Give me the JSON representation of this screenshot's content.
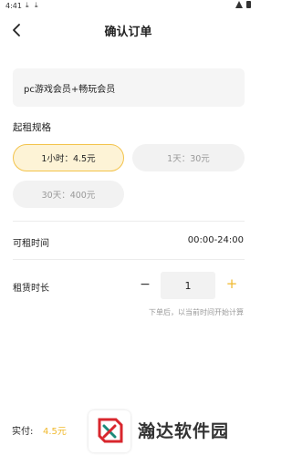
{
  "status_bar": {
    "time": "4:41",
    "icons": [
      "download-icon",
      "download-icon",
      "wifi-icon",
      "battery-icon"
    ]
  },
  "header": {
    "back_icon": "chevron-left-icon",
    "title": "确认订单"
  },
  "product": {
    "name": "pc游戏会员+畅玩会员"
  },
  "spec": {
    "label": "起租规格",
    "options": [
      {
        "label": "1小时：4.5元",
        "selected": true
      },
      {
        "label": "1天：30元",
        "selected": false
      },
      {
        "label": "30天：400元",
        "selected": false
      }
    ]
  },
  "rent_time": {
    "label": "可租时间",
    "value": "00:00-24:00"
  },
  "duration": {
    "label": "租赁时长",
    "minus": "−",
    "value": "1",
    "plus": "+",
    "hint": "下单后，以当前时间开始计算"
  },
  "footer": {
    "pay_label": "实付:",
    "pay_amount": "4.5元"
  },
  "watermark": {
    "text": "瀚达软件园"
  },
  "colors": {
    "accent": "#f0b92d",
    "chip_active_bg": "#fdf3d6",
    "chip_active_border": "#f3c34b",
    "chip_bg": "#f2f2f2"
  }
}
